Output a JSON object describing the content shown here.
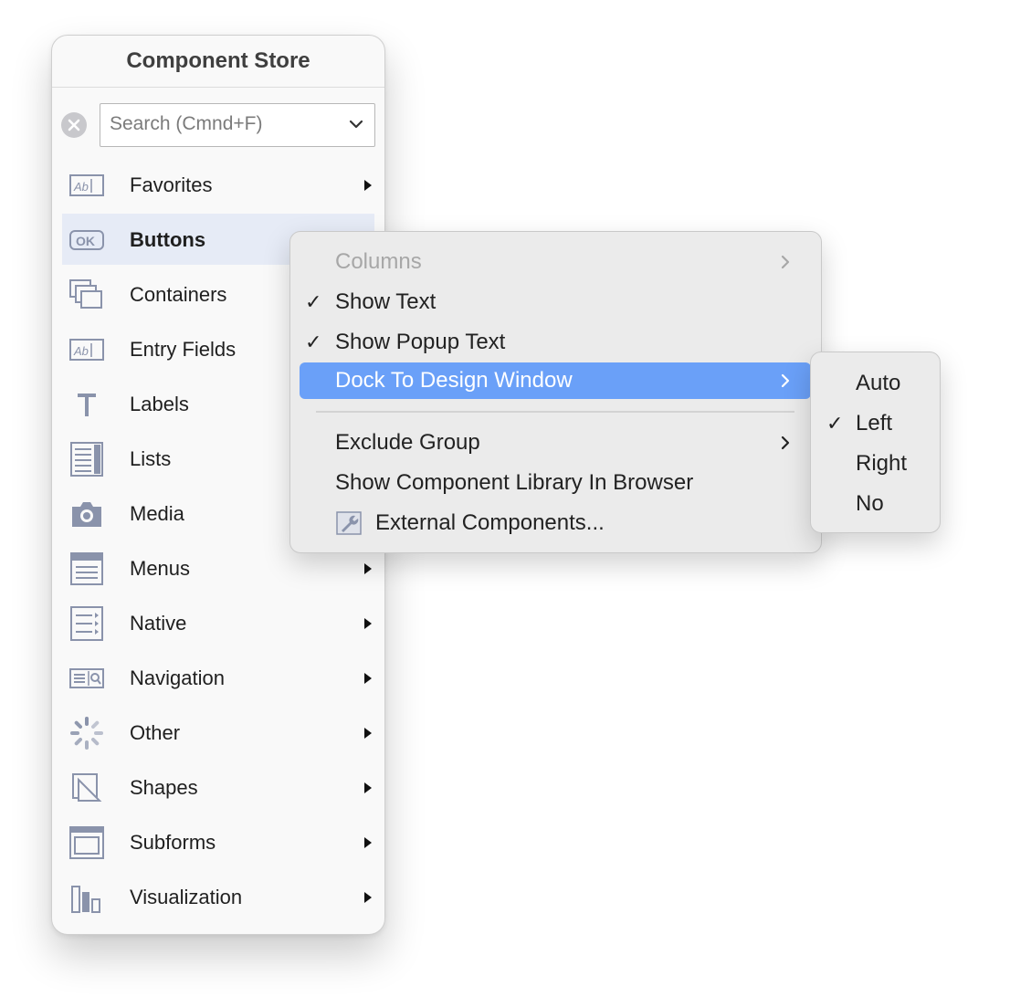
{
  "panel": {
    "title": "Component Store",
    "search": {
      "placeholder": "Search (Cmnd+F)",
      "value": ""
    },
    "categories": [
      {
        "label": "Favorites",
        "icon": "text-field-icon",
        "selected": false,
        "has_arrow": true
      },
      {
        "label": "Buttons",
        "icon": "ok-button-icon",
        "selected": true,
        "has_arrow": false
      },
      {
        "label": "Containers",
        "icon": "stacked-windows-icon",
        "selected": false,
        "has_arrow": false
      },
      {
        "label": "Entry Fields",
        "icon": "text-field-icon",
        "selected": false,
        "has_arrow": false
      },
      {
        "label": "Labels",
        "icon": "letter-t-icon",
        "selected": false,
        "has_arrow": false
      },
      {
        "label": "Lists",
        "icon": "list-icon",
        "selected": false,
        "has_arrow": false
      },
      {
        "label": "Media",
        "icon": "camera-icon",
        "selected": false,
        "has_arrow": false
      },
      {
        "label": "Menus",
        "icon": "menu-icon",
        "selected": false,
        "has_arrow": true
      },
      {
        "label": "Native",
        "icon": "native-list-icon",
        "selected": false,
        "has_arrow": true
      },
      {
        "label": "Navigation",
        "icon": "navigation-search-icon",
        "selected": false,
        "has_arrow": true
      },
      {
        "label": "Other",
        "icon": "spinner-icon",
        "selected": false,
        "has_arrow": true
      },
      {
        "label": "Shapes",
        "icon": "shapes-icon",
        "selected": false,
        "has_arrow": true
      },
      {
        "label": "Subforms",
        "icon": "subform-window-icon",
        "selected": false,
        "has_arrow": true
      },
      {
        "label": "Visualization",
        "icon": "bar-chart-icon",
        "selected": false,
        "has_arrow": true
      }
    ]
  },
  "context_menu": {
    "items": [
      {
        "label": "Columns",
        "checked": false,
        "disabled": true,
        "submenu": true
      },
      {
        "label": "Show Text",
        "checked": true,
        "disabled": false,
        "submenu": false
      },
      {
        "label": "Show Popup Text",
        "checked": true,
        "disabled": false,
        "submenu": false
      },
      {
        "label": "Dock To Design Window",
        "checked": false,
        "disabled": false,
        "submenu": true,
        "active": true
      },
      {
        "label": "Exclude Group",
        "checked": false,
        "disabled": false,
        "submenu": true
      },
      {
        "label": "Show Component Library In Browser",
        "checked": false,
        "disabled": false,
        "submenu": false
      },
      {
        "label": "External Components...",
        "checked": false,
        "disabled": false,
        "submenu": false,
        "icon": "wrench-icon"
      }
    ]
  },
  "dock_submenu": {
    "items": [
      {
        "label": "Auto",
        "checked": false
      },
      {
        "label": "Left",
        "checked": true
      },
      {
        "label": "Right",
        "checked": false
      },
      {
        "label": "No",
        "checked": false
      }
    ]
  },
  "colors": {
    "highlight": "#6aa0f8",
    "selected_row": "#e6ebf6",
    "icon": "#8a93ab"
  }
}
